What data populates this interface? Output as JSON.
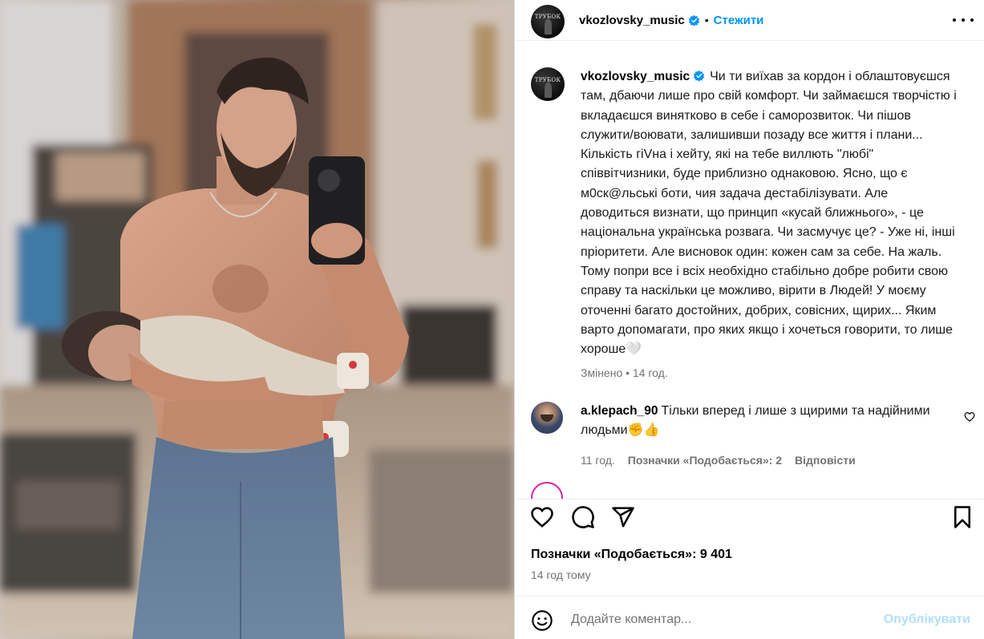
{
  "post": {
    "username": "vkozlovsky_music",
    "follow_label": "Стежити",
    "dot": "•",
    "avatar_text": "ТРУБОК",
    "caption": "Чи ти виїхав за кордон і облаштовуєшся там, дбаючи лише про свій комфорт. Чи займаєшся творчістю і вкладаєшся винятково в себе і саморозвиток. Чи пішов служити/воювати, залишивши позаду все життя і плани... Кількість гіVна і хейту, які на тебе виллють \"любі\" співвітчизники, буде приблизно однаковою. Ясно, що є м0ск@льські боти, чия задача дестабілізувати. Але доводиться визнати, що принцип «кусай ближнього», - це національна українська розвага. Чи засмучує це? - Уже ні, інші пріоритети. Але висновок один: кожен сам за себе. На жаль.\nТому попри все і всіх необхідно стабільно добре робити свою справу та наскільки це можливо, вірити в Людей! У моєму оточенні багато достойних, добрих, совісних, щирих... Яким варто допомагати, про яких якщо і хочеться говорити, то лише хороше🤍",
    "edited_label": "Змінено",
    "edited_time": "14 год."
  },
  "comments": [
    {
      "username": "a.klepach_90",
      "text": "Тільки вперед і лише з щирими та надійними людьми✊👍",
      "time": "11 год.",
      "likes_label": "Позначки «Подобається»: 2",
      "reply_label": "Відповісти"
    }
  ],
  "footer": {
    "likes": "Позначки «Подобається»: 9 401",
    "posted_ago": "14 год тому",
    "comment_placeholder": "Додайте коментар...",
    "publish_label": "Опублікувати"
  },
  "icons": {
    "like": "heart-icon",
    "comment": "comment-icon",
    "share": "share-icon",
    "save": "bookmark-icon",
    "emoji": "emoji-icon",
    "more": "more-options-icon",
    "verified": "verified-badge-icon"
  },
  "colors": {
    "accent": "#0095f6",
    "publish_disabled": "#b2dffc",
    "muted": "#737373"
  }
}
